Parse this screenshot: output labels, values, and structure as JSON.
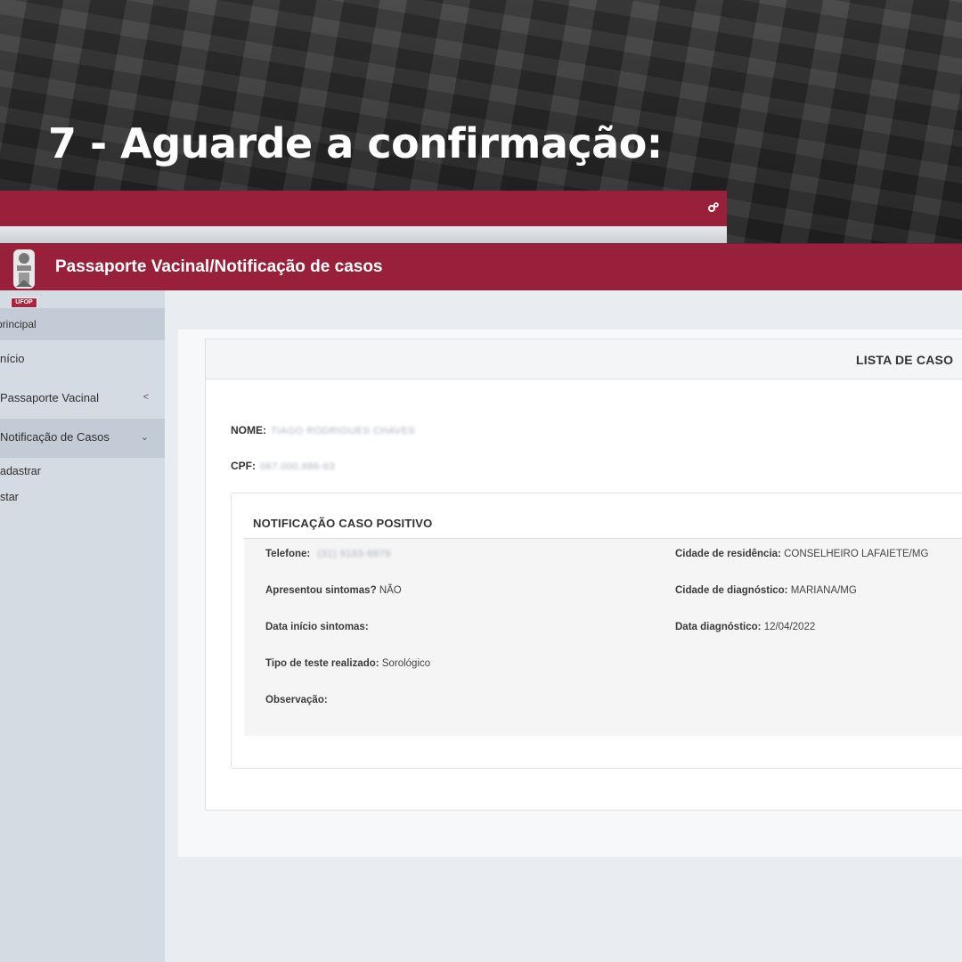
{
  "headline": "7 - Aguarde a confirmação:",
  "app": {
    "title": "Passaporte Vacinal/Notificação de casos",
    "logo_text": "UFOP"
  },
  "sidebar": {
    "section_label": "principal",
    "items": [
      {
        "label": "nício"
      },
      {
        "label": "Passaporte Vacinal",
        "chevron": "<"
      },
      {
        "label": "Notificação de Casos",
        "chevron": "⌄"
      }
    ],
    "subitems": [
      {
        "label": "adastrar"
      },
      {
        "label": "star"
      }
    ]
  },
  "card": {
    "title": "LISTA DE CASO",
    "nome_label": "NOME:",
    "nome_value": "TIAGO RODRIGUES CHAVES",
    "cpf_label": "CPF:",
    "cpf_value": "067.000.686-63"
  },
  "notification": {
    "title": "NOTIFICAÇÃO CASO POSITIVO",
    "telefone_label": "Telefone:",
    "telefone_value": "(31) 9183-8879",
    "sintomas_label": "Apresentou sintomas?",
    "sintomas_value": "NÃO",
    "data_inicio_label": "Data início sintomas:",
    "data_inicio_value": "",
    "tipo_teste_label": "Tipo de teste realizado:",
    "tipo_teste_value": "Sorológico",
    "observacao_label": "Observação:",
    "observacao_value": "",
    "cidade_residencia_label": "Cidade de residência:",
    "cidade_residencia_value": "CONSELHEIRO LAFAIETE/MG",
    "cidade_diagnostico_label": "Cidade de diagnóstico:",
    "cidade_diagnostico_value": "MARIANA/MG",
    "data_diagnostico_label": "Data diagnóstico:",
    "data_diagnostico_value": "12/04/2022"
  },
  "colors": {
    "brand": "#99203a",
    "sidebar": "#d5dbe2",
    "sidebar_active": "#c3ccd6"
  },
  "icons": [
    "gear-icon",
    "chevron-left-icon",
    "chevron-down-icon",
    "ufop-logo"
  ]
}
